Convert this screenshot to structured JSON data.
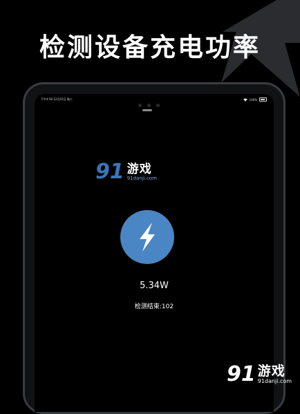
{
  "headline": "检测设备充电功率",
  "device": {
    "status_bar": {
      "time_date": "下午4:58  12月22日 周二",
      "battery_percent": "100%"
    }
  },
  "app": {
    "power_value": "5.34W",
    "detect_status": "检测结束:102"
  },
  "watermark": {
    "number": "91",
    "name": "游戏",
    "url": "91danji.com"
  },
  "colors": {
    "accent": "#4a86c3",
    "background": "#000000",
    "text": "#ffffff"
  }
}
